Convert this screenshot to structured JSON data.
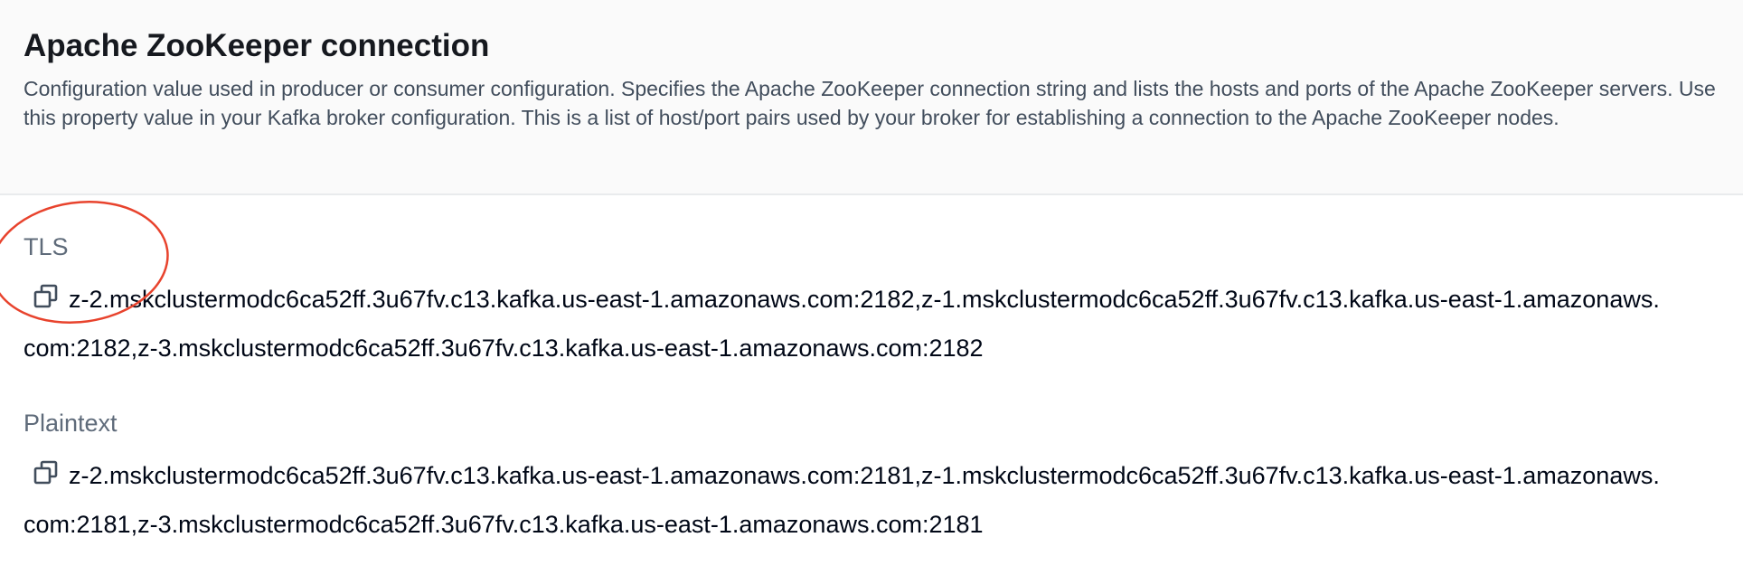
{
  "header": {
    "title": "Apache ZooKeeper connection",
    "description": "Configuration value used in producer or consumer configuration. Specifies the Apache ZooKeeper connection string and lists the hosts and ports of the Apache ZooKeeper servers. Use this property value in your Kafka broker configuration. This is a list of host/port pairs used by your broker for establishing a connection to the Apache ZooKeeper nodes."
  },
  "fields": {
    "tls": {
      "label": "TLS",
      "value": "z-2.mskclustermodc6ca52ff.3u67fv.c13.kafka.us-east-1.amazonaws.com:2182,z-1.mskclustermodc6ca52ff.3u67fv.c13.kafka.us-east-1.amazonaws.com:2182,z-3.mskclustermodc6ca52ff.3u67fv.c13.kafka.us-east-1.amazonaws.com:2182",
      "copy_icon": "copy-icon"
    },
    "plaintext": {
      "label": "Plaintext",
      "value": "z-2.mskclustermodc6ca52ff.3u67fv.c13.kafka.us-east-1.amazonaws.com:2181,z-1.mskclustermodc6ca52ff.3u67fv.c13.kafka.us-east-1.amazonaws.com:2181,z-3.mskclustermodc6ca52ff.3u67fv.c13.kafka.us-east-1.amazonaws.com:2181",
      "copy_icon": "copy-icon"
    }
  },
  "annotation": {
    "color": "#e8432d"
  }
}
